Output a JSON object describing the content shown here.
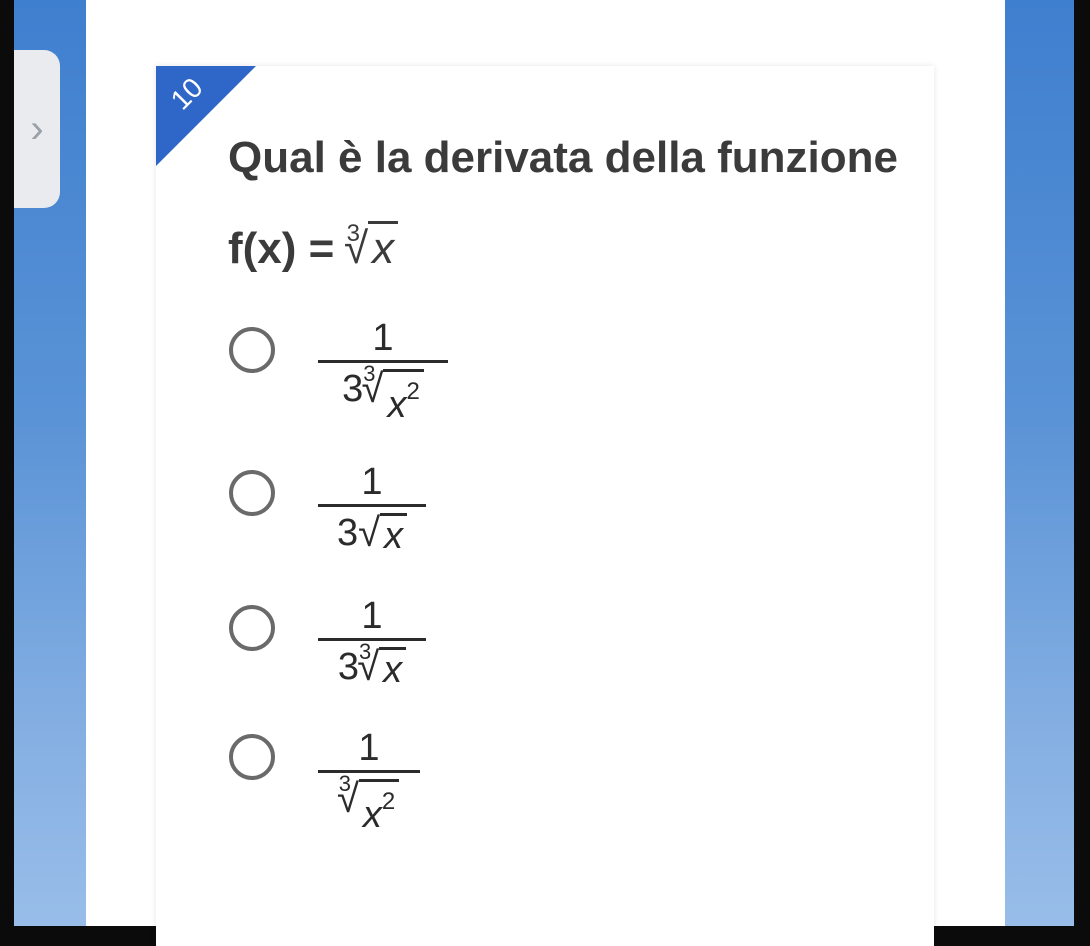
{
  "question": {
    "number": "10",
    "text": "Qual è la derivata della funzione f(x) = ",
    "formula": {
      "index": "3",
      "radicand": "x"
    }
  },
  "options": [
    {
      "numerator": "1",
      "coef": "3",
      "index": "3",
      "radicand": "x",
      "exponent": "2"
    },
    {
      "numerator": "1",
      "coef": "3",
      "index": "",
      "radicand": "x",
      "exponent": ""
    },
    {
      "numerator": "1",
      "coef": "3",
      "index": "3",
      "radicand": "x",
      "exponent": ""
    },
    {
      "numerator": "1",
      "coef": "",
      "index": "3",
      "radicand": "x",
      "exponent": "2"
    }
  ],
  "colors": {
    "accent": "#2f67c8",
    "background_blue": "#4d8ad3",
    "text": "#3b3b3b"
  },
  "icons": {
    "side_tab": "chevron-right-icon",
    "radio": "radio-unchecked-icon"
  }
}
